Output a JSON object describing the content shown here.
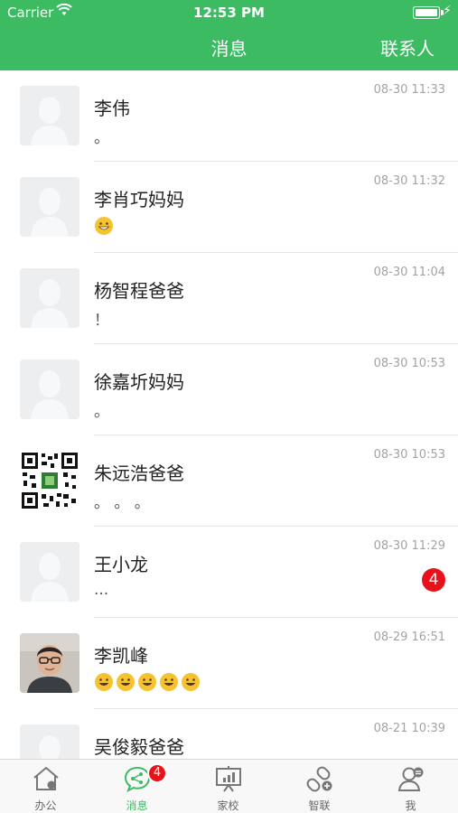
{
  "status_bar": {
    "carrier": "Carrier",
    "time": "12:53 PM"
  },
  "nav": {
    "title": "消息",
    "right_button": "联系人"
  },
  "colors": {
    "brand_green": "#3dbb63",
    "badge_red": "#e8121b"
  },
  "conversations": [
    {
      "name": "李伟",
      "preview": "。",
      "time": "08-30 11:33",
      "avatar": "placeholder"
    },
    {
      "name": "李肖巧妈妈",
      "preview": "",
      "emoji_count": 1,
      "time": "08-30 11:32",
      "avatar": "placeholder"
    },
    {
      "name": "杨智程爸爸",
      "preview": "！",
      "time": "08-30 11:04",
      "avatar": "placeholder"
    },
    {
      "name": "徐嘉圻妈妈",
      "preview": "。",
      "time": "08-30 10:53",
      "avatar": "placeholder"
    },
    {
      "name": "朱远浩爸爸",
      "preview": "。 。 。",
      "time": "08-30 10:53",
      "avatar": "qr-code"
    },
    {
      "name": "王小龙",
      "preview": "...",
      "time": "08-30 11:29",
      "unread": "4",
      "avatar": "placeholder"
    },
    {
      "name": "李凯峰",
      "preview": "",
      "emoji_count": 5,
      "time": "08-29 16:51",
      "avatar": "photo"
    },
    {
      "name": "吴俊毅爸爸",
      "preview": "",
      "time": "08-21 10:39",
      "avatar": "placeholder"
    }
  ],
  "tabbar": {
    "items": [
      {
        "label": "办公",
        "icon": "office-icon"
      },
      {
        "label": "消息",
        "icon": "chat-share-icon",
        "badge": "4",
        "active": true
      },
      {
        "label": "家校",
        "icon": "board-chart-icon"
      },
      {
        "label": "智联",
        "icon": "link-plus-icon"
      },
      {
        "label": "我",
        "icon": "user-icon"
      }
    ]
  }
}
